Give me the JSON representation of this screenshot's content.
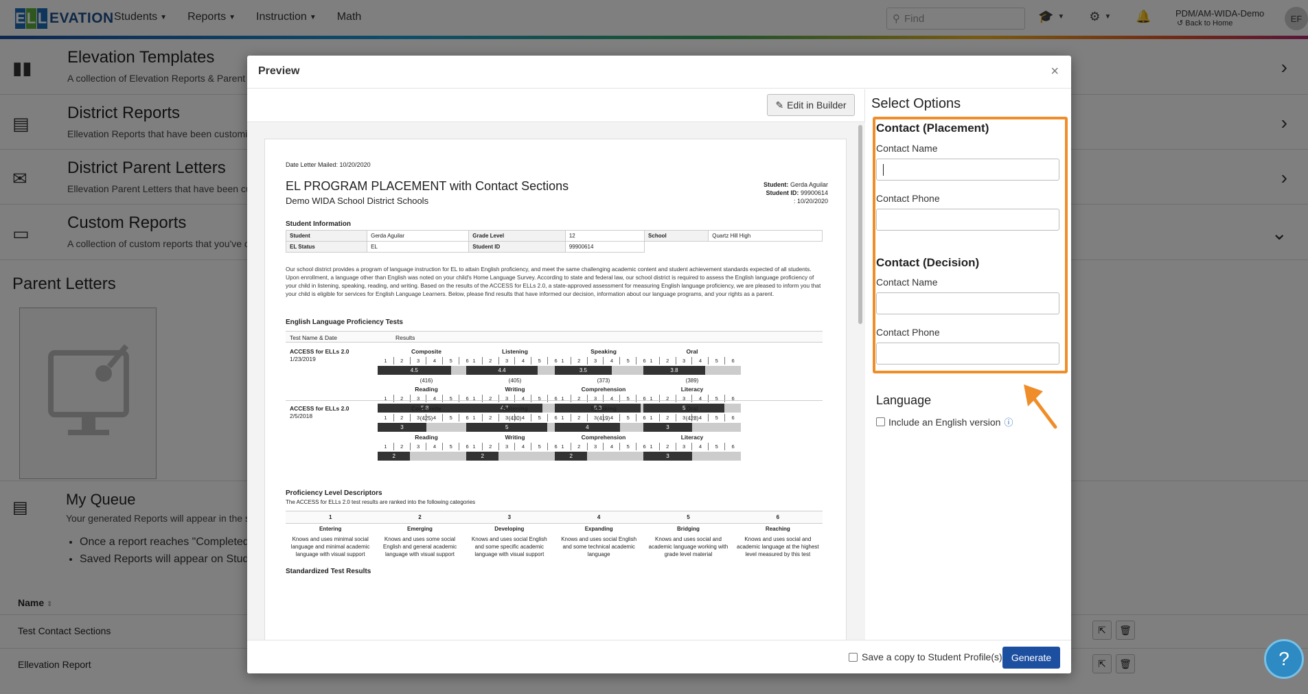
{
  "nav": {
    "logo_left": "EL",
    "logo_rest": "EVATION",
    "items": [
      {
        "label": "Students"
      },
      {
        "label": "Reports"
      },
      {
        "label": "Instruction"
      },
      {
        "label": "Math"
      }
    ],
    "search_placeholder": "Find",
    "district": "PDM/AM-WIDA-Demo",
    "back_home": "Back to Home",
    "avatar": "EF"
  },
  "background": {
    "rows": [
      {
        "title": "Elevation Templates",
        "desc": "A collection of Elevation Reports & Parent"
      },
      {
        "title": "District Reports",
        "desc": "Ellevation Reports that have been customiz"
      },
      {
        "title": "District Parent Letters",
        "desc": "Ellevation Parent Letters that have been cu"
      },
      {
        "title": "Custom Reports",
        "desc": "A collection of custom reports that you've c"
      }
    ],
    "parent_letters": "Parent Letters",
    "queue": {
      "title": "My Queue",
      "desc": "Your generated Reports will appear in the s",
      "bullets": [
        "Once a report reaches \"Completed",
        "Saved Reports will appear on Stud"
      ]
    },
    "table": {
      "name_header": "Name",
      "rows": [
        "Test Contact Sections",
        "Ellevation Report"
      ]
    }
  },
  "modal": {
    "title": "Preview",
    "close": "×",
    "edit_button": "Edit in Builder",
    "options_title": "Select Options",
    "placement": {
      "heading": "Contact (Placement)",
      "name_label": "Contact Name",
      "name_value": "",
      "phone_label": "Contact Phone",
      "phone_value": ""
    },
    "decision": {
      "heading": "Contact (Decision)",
      "name_label": "Contact Name",
      "name_value": "",
      "phone_label": "Contact Phone",
      "phone_value": ""
    },
    "language": {
      "heading": "Language",
      "checkbox_label": "Include an English version",
      "checked": false
    },
    "footer": {
      "save_copy": "Save a copy to Student Profile(s)",
      "save_copy_checked": false,
      "generate": "Generate"
    },
    "highlight_color": "#ef8d2a"
  },
  "doc": {
    "mailed": "Date Letter Mailed: 10/20/2020",
    "title": "EL PROGRAM PLACEMENT with Contact Sections",
    "subtitle": "Demo WIDA School District Schools",
    "meta_student_label": "Student:",
    "meta_student": "Gerda Aguilar",
    "meta_id_label": "Student ID:",
    "meta_id": "99900614",
    "meta_date": ": 10/20/2020",
    "student_info_heading": "Student Information",
    "info": {
      "student_label": "Student",
      "student": "Gerda Aguilar",
      "grade_label": "Grade Level",
      "grade": "12",
      "school_label": "School",
      "school": "Quartz Hill High",
      "status_label": "EL Status",
      "status": "EL",
      "id_label": "Student ID",
      "id": "99900614"
    },
    "paragraph": "Our school district provides a program of language instruction for EL to attain English proficiency, and meet the same challenging academic content and student achievement standards expected of all students. Upon enrollment, a language other than English was noted on your child's Home Language Survey. According to state and federal law, our school district is required to assess the English language proficiency of your child in listening, speaking, reading, and writing. Based on the results of the ACCESS for ELLs 2.0, a state-approved assessment for measuring English language proficiency, we are pleased to inform you that your child is eligible for services for English Language Learners. Below, please find results that have informed our decision, information about our language programs, and your rights as a parent.",
    "elp_heading": "English Language Proficiency Tests",
    "col_test": "Test Name & Date",
    "col_results": "Results",
    "tests": [
      {
        "name": "ACCESS for ELLs 2.0",
        "date": "1/23/2019",
        "rows": [
          [
            {
              "label": "Composite",
              "value": "4.5",
              "level": 4.5,
              "score": "(416)"
            },
            {
              "label": "Listening",
              "value": "4.4",
              "level": 4.4,
              "score": "(405)"
            },
            {
              "label": "Speaking",
              "value": "3.5",
              "level": 3.5,
              "score": "(373)"
            },
            {
              "label": "Oral",
              "value": "3.8",
              "level": 3.8,
              "score": "(389)"
            }
          ],
          [
            {
              "label": "Reading",
              "value": "5.8",
              "level": 5.8,
              "score": "(425)"
            },
            {
              "label": "Writing",
              "value": "4.7",
              "level": 4.7,
              "score": "(430)"
            },
            {
              "label": "Comprehension",
              "value": "5.3",
              "level": 5.3,
              "score": "(419)"
            },
            {
              "label": "Literacy",
              "value": "5",
              "level": 5.0,
              "score": "(428)"
            }
          ]
        ]
      },
      {
        "name": "ACCESS for ELLs 2.0",
        "date": "2/5/2018",
        "rows": [
          [
            {
              "label": "Composite",
              "value": "3",
              "level": 3,
              "score": ""
            },
            {
              "label": "Listening",
              "value": "5",
              "level": 5,
              "score": ""
            },
            {
              "label": "Speaking",
              "value": "4",
              "level": 4,
              "score": ""
            },
            {
              "label": "Oral",
              "value": "3",
              "level": 3,
              "score": ""
            }
          ],
          [
            {
              "label": "Reading",
              "value": "2",
              "level": 2,
              "score": ""
            },
            {
              "label": "Writing",
              "value": "2",
              "level": 2,
              "score": ""
            },
            {
              "label": "Comprehension",
              "value": "2",
              "level": 2,
              "score": ""
            },
            {
              "label": "Literacy",
              "value": "3",
              "level": 3,
              "score": ""
            }
          ]
        ]
      }
    ],
    "scale": [
      "1",
      "2",
      "3",
      "4",
      "5",
      "6"
    ],
    "pld_heading": "Proficiency Level Descriptors",
    "pld_sub": "The ACCESS for ELLs 2.0 test results are ranked into the following categories",
    "levels": [
      {
        "num": "1",
        "name": "Entering",
        "desc": "Knows and uses minimal social language and minimal academic language with visual support"
      },
      {
        "num": "2",
        "name": "Emerging",
        "desc": "Knows and uses some social English and general academic language with visual support"
      },
      {
        "num": "3",
        "name": "Developing",
        "desc": "Knows and uses social English and some specific academic language with visual support"
      },
      {
        "num": "4",
        "name": "Expanding",
        "desc": "Knows and uses social English and some technical academic language"
      },
      {
        "num": "5",
        "name": "Bridging",
        "desc": "Knows and uses social and academic language working with grade level material"
      },
      {
        "num": "6",
        "name": "Reaching",
        "desc": "Knows and uses social and academic language at the highest level measured by this test"
      }
    ],
    "std_heading": "Standardized Test Results"
  }
}
